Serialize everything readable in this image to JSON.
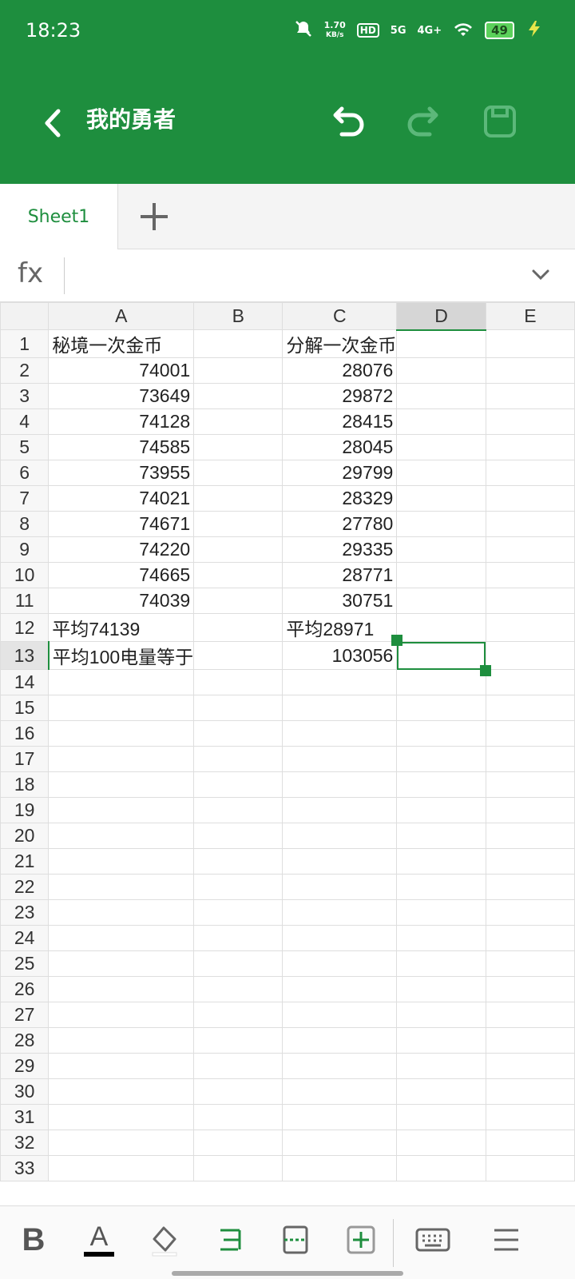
{
  "status": {
    "time": "18:23",
    "net_speed_value": "1.70",
    "net_speed_unit": "KB/s",
    "hd": "HD",
    "sim1": "5G",
    "sim2": "4G+",
    "battery": "49"
  },
  "app": {
    "title": "我的勇者",
    "accent": "#1e8e3e"
  },
  "tabs": {
    "sheet1": "Sheet1"
  },
  "formula": {
    "fx": "fx",
    "value": ""
  },
  "columns": [
    "A",
    "B",
    "C",
    "D",
    "E"
  ],
  "selected_cell": "D13",
  "cells": {
    "A1": "秘境一次金币",
    "C1": "分解一次金币",
    "A2": "74001",
    "C2": "28076",
    "A3": "73649",
    "C3": "29872",
    "A4": "74128",
    "C4": "28415",
    "A5": "74585",
    "C5": "28045",
    "A6": "73955",
    "C6": "29799",
    "A7": "74021",
    "C7": "28329",
    "A8": "74671",
    "C8": "27780",
    "A9": "74220",
    "C9": "29335",
    "A10": "74665",
    "C10": "28771",
    "A11": "74039",
    "C11": "30751",
    "A12": "平均74139",
    "C12": "平均28971",
    "A13": "平均100电量等于",
    "C13": "103056"
  },
  "rows": [
    "1",
    "2",
    "3",
    "4",
    "5",
    "6",
    "7",
    "8",
    "9",
    "10",
    "11",
    "12",
    "13",
    "14",
    "15",
    "16",
    "17",
    "18",
    "19",
    "20",
    "21",
    "22",
    "23",
    "24",
    "25",
    "26",
    "27",
    "28",
    "29",
    "30",
    "31",
    "32",
    "33"
  ],
  "toolbar": {
    "bold": "B",
    "font_color": "A"
  }
}
